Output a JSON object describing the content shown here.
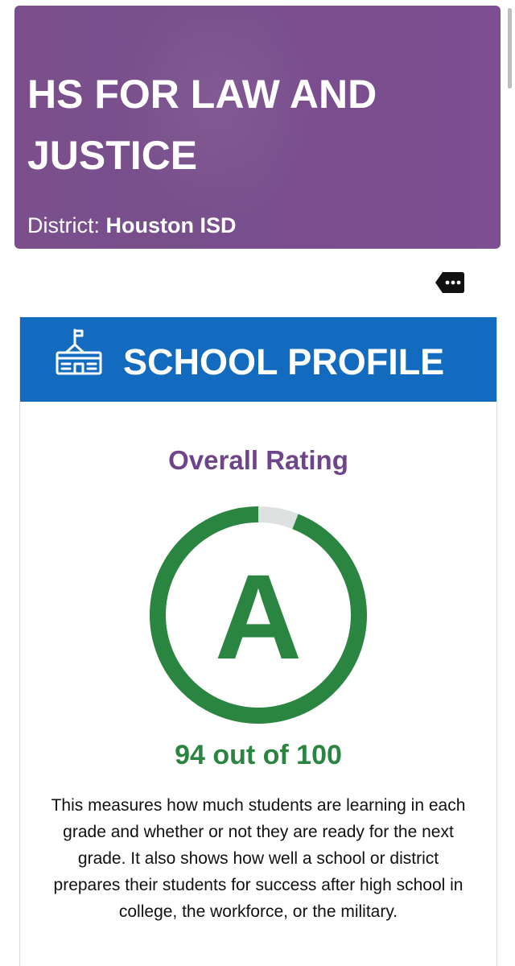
{
  "school": {
    "name": "HS FOR LAW AND JUSTICE",
    "district_label": "District:",
    "district_name": "Houston ISD"
  },
  "ad_badge": {
    "icon": "more-dots-icon"
  },
  "profile": {
    "header_icon": "school-building-icon",
    "title": "SCHOOL PROFILE",
    "rating_label": "Overall Rating",
    "grade": "A",
    "score_value": 94,
    "score_max": 100,
    "score_text": "94 out of 100",
    "description": "This measures how much students are learning in each grade and whether or not they are ready for the next grade. It also shows how well a school or district prepares their students for success after high school in college, the workforce, or the military."
  },
  "colors": {
    "hero_purple": "#774f8b",
    "header_blue": "#136bbf",
    "rating_purple": "#6e4589",
    "grade_green": "#2a8540",
    "gauge_track": "#dde1e0"
  }
}
